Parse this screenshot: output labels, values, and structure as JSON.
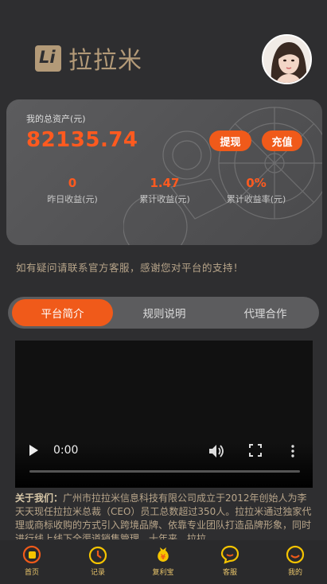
{
  "header": {
    "logo_mark": "Li",
    "logo_text": "拉拉米"
  },
  "asset_card": {
    "label": "我的总资产(元)",
    "total": "82135.74",
    "withdraw_label": "提现",
    "recharge_label": "充值",
    "stats": [
      {
        "value": "0",
        "label": "昨日收益(元)"
      },
      {
        "value": "1.47",
        "label": "累计收益(元)"
      },
      {
        "value": "0%",
        "label": "累计收益率(元)"
      }
    ]
  },
  "notice": "如有疑问请联系官方客服，感谢您对平台的支持！",
  "tabs": [
    "平台简介",
    "规则说明",
    "代理合作"
  ],
  "video": {
    "time": "0:00"
  },
  "about": {
    "title": "关于我们：",
    "text": "广州市拉拉米信息科技有限公司成立于2012年创始人为李天天现任拉拉米总裁（CEO）员工总数超过350人。拉拉米通过独家代理或商标收购的方式引入跨境品牌、依靠专业团队打造品牌形象，同时进行线上线下全渠道销售管理。十年来，拉拉"
  },
  "tabbar": [
    "首页",
    "记录",
    "复利宝",
    "客服",
    "我的"
  ],
  "colors": {
    "accent": "#f05a1a",
    "gold": "#b39a78",
    "icon_yellow": "#f5c400"
  }
}
